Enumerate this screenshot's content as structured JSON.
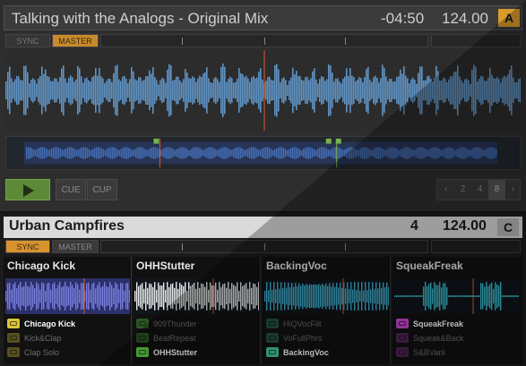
{
  "deck_a": {
    "title": "Talking with the Analogs - Original Mix",
    "time": "-04:50",
    "bpm": "124.00",
    "letter": "A",
    "sync_label": "SYNC",
    "master_label": "MASTER",
    "cue_label": "CUE",
    "cup_label": "CUP",
    "loop_sizes": [
      "2",
      "4",
      "8"
    ],
    "loop_selected": "8",
    "loop_prev_icon": "chevron-left-icon",
    "loop_next_icon": "chevron-right-icon",
    "play_icon": "play-icon",
    "accent": "#d89b2a",
    "waveform_color": "#6aa6df",
    "play_color": "#5c8a38"
  },
  "deck_b": {
    "title": "Urban Campfires",
    "number": "4",
    "bpm": "124.00",
    "letter": "C",
    "sync_label": "SYNC",
    "master_label": "MASTER",
    "accent": "#d8932e",
    "slots": [
      {
        "title": "Chicago Kick",
        "wave_color": "#7f85e8",
        "cell_color": "#d9c23a",
        "cells": [
          {
            "label": "Chicago Kick",
            "active": true
          },
          {
            "label": "Kick&Clap",
            "active": false
          },
          {
            "label": "Clap Solo",
            "active": false
          }
        ]
      },
      {
        "title": "OHHStutter",
        "wave_color": "#ffffff",
        "cell_color": "#62d648",
        "cells": [
          {
            "label": "909Thunder",
            "active": false
          },
          {
            "label": "BeatRepeat",
            "active": false
          },
          {
            "label": "OHHStutter",
            "active": true
          }
        ]
      },
      {
        "title": "BackingVoc",
        "wave_color": "#47c0e6",
        "cell_color": "#48c8a0",
        "cells": [
          {
            "label": "HiQVocFilt",
            "active": false
          },
          {
            "label": "VoFullPhrs",
            "active": false
          },
          {
            "label": "BackingVoc",
            "active": true
          }
        ]
      },
      {
        "title": "SqueakFreak",
        "wave_color": "#40d0e6",
        "cell_color": "#c84ad0",
        "cells": [
          {
            "label": "SqueakFreak",
            "active": true
          },
          {
            "label": "Squeak&Back",
            "active": false
          },
          {
            "label": "S&BVaril",
            "active": false
          }
        ]
      }
    ]
  }
}
